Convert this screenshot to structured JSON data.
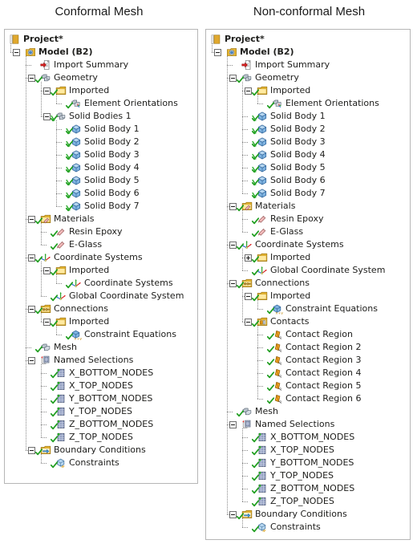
{
  "titles": {
    "left": "Conformal Mesh",
    "right": "Non-conformal Mesh"
  },
  "icon_colors": {
    "folder": "#e8b732",
    "folder_light": "#ffe9a0",
    "check_green": "#1f9e1f",
    "cross_green": "#2cab2c",
    "body_blue": "#4a8fd0",
    "geometry_gray": "#c9ced6",
    "red_arrow": "#d81f1f",
    "project_gold": "#e0a82e",
    "contact_orange": "#f0a020",
    "nodes_purple": "#7a7fb0",
    "material_pink": "#f0b4b4",
    "panel_border": "#b6b6b6",
    "text": "#20201e",
    "line_gray": "#8a8a8a"
  },
  "left_tree": [
    {
      "label": "Project*",
      "depth": 0,
      "icon": "project-icon",
      "exp": "none",
      "check": "none",
      "bold": true
    },
    {
      "label": "Model (B2)",
      "depth": 1,
      "icon": "model-icon",
      "exp": "minus",
      "check": "none",
      "bold": true
    },
    {
      "label": "Import Summary",
      "depth": 2,
      "icon": "import-summary-icon",
      "exp": "none",
      "check": "none",
      "bold": false
    },
    {
      "label": "Geometry",
      "depth": 2,
      "icon": "geometry-icon",
      "exp": "minus",
      "check": "check",
      "bold": false
    },
    {
      "label": "Imported",
      "depth": 3,
      "icon": "folder-icon",
      "exp": "minus",
      "check": "check",
      "bold": false
    },
    {
      "label": "Element Orientations",
      "depth": 4,
      "icon": "element-orientations-icon",
      "exp": "none",
      "check": "check",
      "bold": false
    },
    {
      "label": "Solid Bodies 1",
      "depth": 3,
      "icon": "geometry-icon",
      "exp": "minus",
      "check": "cross",
      "bold": false
    },
    {
      "label": "Solid Body 1",
      "depth": 4,
      "icon": "solid-body-icon",
      "exp": "none",
      "check": "cross",
      "bold": false
    },
    {
      "label": "Solid Body 2",
      "depth": 4,
      "icon": "solid-body-icon",
      "exp": "none",
      "check": "cross",
      "bold": false
    },
    {
      "label": "Solid Body 3",
      "depth": 4,
      "icon": "solid-body-icon",
      "exp": "none",
      "check": "cross",
      "bold": false
    },
    {
      "label": "Solid Body 4",
      "depth": 4,
      "icon": "solid-body-icon",
      "exp": "none",
      "check": "cross",
      "bold": false
    },
    {
      "label": "Solid Body 5",
      "depth": 4,
      "icon": "solid-body-icon",
      "exp": "none",
      "check": "cross",
      "bold": false
    },
    {
      "label": "Solid Body 6",
      "depth": 4,
      "icon": "solid-body-icon",
      "exp": "none",
      "check": "cross",
      "bold": false
    },
    {
      "label": "Solid Body 7",
      "depth": 4,
      "icon": "solid-body-icon",
      "exp": "none",
      "check": "cross",
      "bold": false
    },
    {
      "label": "Materials",
      "depth": 2,
      "icon": "materials-icon",
      "exp": "minus",
      "check": "check",
      "bold": false
    },
    {
      "label": "Resin Epoxy",
      "depth": 3,
      "icon": "material-icon",
      "exp": "none",
      "check": "check",
      "bold": false
    },
    {
      "label": "E-Glass",
      "depth": 3,
      "icon": "material-icon",
      "exp": "none",
      "check": "check",
      "bold": false
    },
    {
      "label": "Coordinate Systems",
      "depth": 2,
      "icon": "coordinate-system-icon",
      "exp": "minus",
      "check": "check",
      "bold": false
    },
    {
      "label": "Imported",
      "depth": 3,
      "icon": "folder-icon",
      "exp": "minus",
      "check": "check",
      "bold": false
    },
    {
      "label": "Coordinate Systems",
      "depth": 4,
      "icon": "coordinate-system-icon",
      "exp": "none",
      "check": "check",
      "bold": false
    },
    {
      "label": "Global Coordinate System",
      "depth": 3,
      "icon": "coordinate-system-icon",
      "exp": "none",
      "check": "check",
      "bold": false
    },
    {
      "label": "Connections",
      "depth": 2,
      "icon": "connections-icon",
      "exp": "minus",
      "check": "check",
      "bold": false
    },
    {
      "label": "Imported",
      "depth": 3,
      "icon": "folder-icon",
      "exp": "minus",
      "check": "check",
      "bold": false
    },
    {
      "label": "Constraint Equations",
      "depth": 4,
      "icon": "constraint-equations-icon",
      "exp": "none",
      "check": "check",
      "bold": false
    },
    {
      "label": "Mesh",
      "depth": 2,
      "icon": "mesh-icon",
      "exp": "none",
      "check": "check",
      "bold": false
    },
    {
      "label": "Named Selections",
      "depth": 2,
      "icon": "named-selections-icon",
      "exp": "minus",
      "check": "none",
      "bold": false
    },
    {
      "label": "X_BOTTOM_NODES",
      "depth": 3,
      "icon": "nodes-icon",
      "exp": "none",
      "check": "check",
      "bold": false
    },
    {
      "label": "X_TOP_NODES",
      "depth": 3,
      "icon": "nodes-icon",
      "exp": "none",
      "check": "check",
      "bold": false
    },
    {
      "label": "Y_BOTTOM_NODES",
      "depth": 3,
      "icon": "nodes-icon",
      "exp": "none",
      "check": "check",
      "bold": false
    },
    {
      "label": "Y_TOP_NODES",
      "depth": 3,
      "icon": "nodes-icon",
      "exp": "none",
      "check": "check",
      "bold": false
    },
    {
      "label": "Z_BOTTOM_NODES",
      "depth": 3,
      "icon": "nodes-icon",
      "exp": "none",
      "check": "check",
      "bold": false
    },
    {
      "label": "Z_TOP_NODES",
      "depth": 3,
      "icon": "nodes-icon",
      "exp": "none",
      "check": "check",
      "bold": false
    },
    {
      "label": "Boundary Conditions",
      "depth": 2,
      "icon": "boundary-conditions-icon",
      "exp": "minus",
      "check": "check",
      "bold": false
    },
    {
      "label": "Constraints",
      "depth": 3,
      "icon": "constraints-icon",
      "exp": "none",
      "check": "check",
      "bold": false
    }
  ],
  "right_tree": [
    {
      "label": "Project*",
      "depth": 0,
      "icon": "project-icon",
      "exp": "none",
      "check": "none",
      "bold": true
    },
    {
      "label": "Model (B2)",
      "depth": 1,
      "icon": "model-icon",
      "exp": "minus",
      "check": "none",
      "bold": true
    },
    {
      "label": "Import Summary",
      "depth": 2,
      "icon": "import-summary-icon",
      "exp": "none",
      "check": "none",
      "bold": false
    },
    {
      "label": "Geometry",
      "depth": 2,
      "icon": "geometry-icon",
      "exp": "minus",
      "check": "check",
      "bold": false
    },
    {
      "label": "Imported",
      "depth": 3,
      "icon": "folder-icon",
      "exp": "minus",
      "check": "check",
      "bold": false
    },
    {
      "label": "Element Orientations",
      "depth": 4,
      "icon": "element-orientations-icon",
      "exp": "none",
      "check": "check",
      "bold": false
    },
    {
      "label": "Solid Body 1",
      "depth": 3,
      "icon": "solid-body-icon",
      "exp": "none",
      "check": "cross",
      "bold": false
    },
    {
      "label": "Solid Body 2",
      "depth": 3,
      "icon": "solid-body-icon",
      "exp": "none",
      "check": "cross",
      "bold": false
    },
    {
      "label": "Solid Body 3",
      "depth": 3,
      "icon": "solid-body-icon",
      "exp": "none",
      "check": "cross",
      "bold": false
    },
    {
      "label": "Solid Body 4",
      "depth": 3,
      "icon": "solid-body-icon",
      "exp": "none",
      "check": "cross",
      "bold": false
    },
    {
      "label": "Solid Body 5",
      "depth": 3,
      "icon": "solid-body-icon",
      "exp": "none",
      "check": "cross",
      "bold": false
    },
    {
      "label": "Solid Body 6",
      "depth": 3,
      "icon": "solid-body-icon",
      "exp": "none",
      "check": "cross",
      "bold": false
    },
    {
      "label": "Solid Body 7",
      "depth": 3,
      "icon": "solid-body-icon",
      "exp": "none",
      "check": "cross",
      "bold": false
    },
    {
      "label": "Materials",
      "depth": 2,
      "icon": "materials-icon",
      "exp": "minus",
      "check": "check",
      "bold": false
    },
    {
      "label": "Resin Epoxy",
      "depth": 3,
      "icon": "material-icon",
      "exp": "none",
      "check": "check",
      "bold": false
    },
    {
      "label": "E-Glass",
      "depth": 3,
      "icon": "material-icon",
      "exp": "none",
      "check": "check",
      "bold": false
    },
    {
      "label": "Coordinate Systems",
      "depth": 2,
      "icon": "coordinate-system-icon",
      "exp": "minus",
      "check": "check",
      "bold": false
    },
    {
      "label": "Imported",
      "depth": 3,
      "icon": "folder-icon",
      "exp": "plus",
      "check": "check",
      "bold": false
    },
    {
      "label": "Global Coordinate System",
      "depth": 3,
      "icon": "coordinate-system-icon",
      "exp": "none",
      "check": "check",
      "bold": false
    },
    {
      "label": "Connections",
      "depth": 2,
      "icon": "connections-icon",
      "exp": "minus",
      "check": "check",
      "bold": false
    },
    {
      "label": "Imported",
      "depth": 3,
      "icon": "folder-icon",
      "exp": "minus",
      "check": "check",
      "bold": false
    },
    {
      "label": "Constraint Equations",
      "depth": 4,
      "icon": "constraint-equations-icon",
      "exp": "none",
      "check": "check",
      "bold": false
    },
    {
      "label": "Contacts",
      "depth": 3,
      "icon": "contacts-icon",
      "exp": "minus",
      "check": "check",
      "bold": false
    },
    {
      "label": "Contact Region",
      "depth": 4,
      "icon": "contact-region-icon",
      "exp": "none",
      "check": "check",
      "bold": false
    },
    {
      "label": "Contact Region 2",
      "depth": 4,
      "icon": "contact-region-icon",
      "exp": "none",
      "check": "check",
      "bold": false
    },
    {
      "label": "Contact Region 3",
      "depth": 4,
      "icon": "contact-region-icon",
      "exp": "none",
      "check": "check",
      "bold": false
    },
    {
      "label": "Contact Region 4",
      "depth": 4,
      "icon": "contact-region-icon",
      "exp": "none",
      "check": "check",
      "bold": false
    },
    {
      "label": "Contact Region 5",
      "depth": 4,
      "icon": "contact-region-icon",
      "exp": "none",
      "check": "check",
      "bold": false
    },
    {
      "label": "Contact Region 6",
      "depth": 4,
      "icon": "contact-region-icon",
      "exp": "none",
      "check": "check",
      "bold": false
    },
    {
      "label": "Mesh",
      "depth": 2,
      "icon": "mesh-icon",
      "exp": "none",
      "check": "check",
      "bold": false
    },
    {
      "label": "Named Selections",
      "depth": 2,
      "icon": "named-selections-icon",
      "exp": "minus",
      "check": "none",
      "bold": false
    },
    {
      "label": "X_BOTTOM_NODES",
      "depth": 3,
      "icon": "nodes-icon",
      "exp": "none",
      "check": "check",
      "bold": false
    },
    {
      "label": "X_TOP_NODES",
      "depth": 3,
      "icon": "nodes-icon",
      "exp": "none",
      "check": "check",
      "bold": false
    },
    {
      "label": "Y_BOTTOM_NODES",
      "depth": 3,
      "icon": "nodes-icon",
      "exp": "none",
      "check": "check",
      "bold": false
    },
    {
      "label": "Y_TOP_NODES",
      "depth": 3,
      "icon": "nodes-icon",
      "exp": "none",
      "check": "check",
      "bold": false
    },
    {
      "label": "Z_BOTTOM_NODES",
      "depth": 3,
      "icon": "nodes-icon",
      "exp": "none",
      "check": "check",
      "bold": false
    },
    {
      "label": "Z_TOP_NODES",
      "depth": 3,
      "icon": "nodes-icon",
      "exp": "none",
      "check": "check",
      "bold": false
    },
    {
      "label": "Boundary Conditions",
      "depth": 2,
      "icon": "boundary-conditions-icon",
      "exp": "minus",
      "check": "check",
      "bold": false
    },
    {
      "label": "Constraints",
      "depth": 3,
      "icon": "constraints-icon",
      "exp": "none",
      "check": "check",
      "bold": false
    }
  ]
}
